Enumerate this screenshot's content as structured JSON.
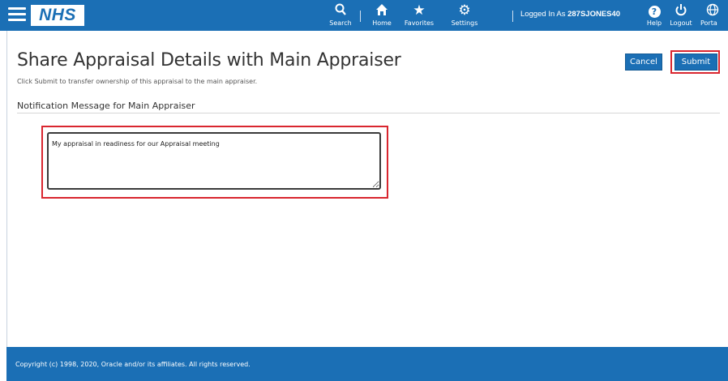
{
  "header": {
    "logo_text": "NHS",
    "nav": [
      {
        "label": "Search",
        "icon": "search-icon"
      },
      {
        "label": "Home",
        "icon": "home-icon"
      },
      {
        "label": "Favorites",
        "icon": "star-icon"
      },
      {
        "label": "Settings",
        "icon": "gear-icon"
      },
      {
        "label": "Help",
        "icon": "help-icon"
      },
      {
        "label": "Logout",
        "icon": "power-icon"
      },
      {
        "label": "Porta",
        "icon": "globe-icon"
      }
    ],
    "logged_in_prefix": "Logged In As",
    "logged_in_user": "287SJONES40"
  },
  "page": {
    "title": "Share Appraisal Details with Main Appraiser",
    "subtitle": "Click Submit to transfer ownership of this appraisal to the main appraiser.",
    "section_label": "Notification Message for Main Appraiser",
    "message_value": "My appraisal in readiness for our Appraisal meeting"
  },
  "actions": {
    "cancel_label": "Cancel",
    "submit_label": "Submit"
  },
  "footer": {
    "copyright": "Copyright (c) 1998, 2020, Oracle and/or its affiliates. All rights reserved."
  },
  "colors": {
    "brand_blue": "#1b6fb5",
    "highlight_red": "#d9262f"
  }
}
